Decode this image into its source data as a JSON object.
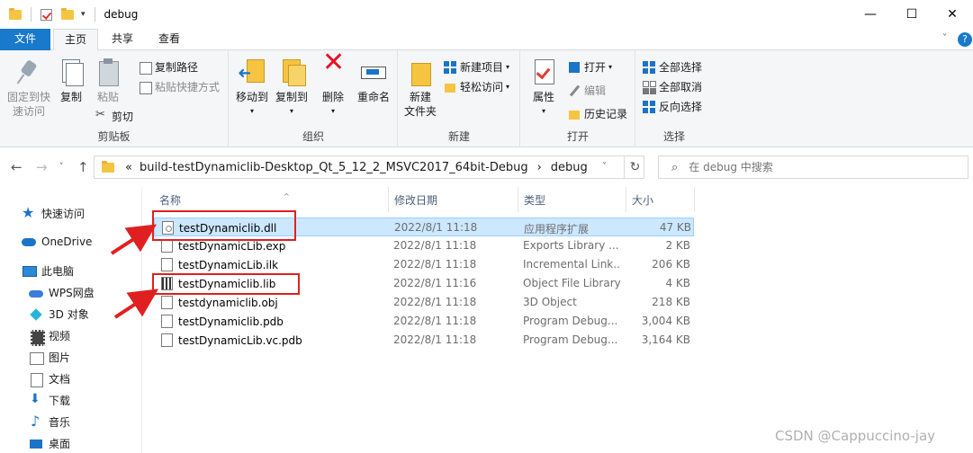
{
  "window": {
    "title": "debug",
    "minimize": "—",
    "maximize": "☐",
    "close": "✕"
  },
  "tabs": [
    {
      "label": "文件"
    },
    {
      "label": "主页"
    },
    {
      "label": "共享"
    },
    {
      "label": "查看"
    }
  ],
  "help": "?",
  "ribbon": {
    "clipboard": {
      "group_label": "剪贴板",
      "pin_quick_access_line1": "固定到快",
      "pin_quick_access_line2": "速访问",
      "copy": "复制",
      "paste": "粘贴",
      "copy_path": "复制路径",
      "paste_shortcut": "粘贴快捷方式",
      "cut": "剪切"
    },
    "organize": {
      "group_label": "组织",
      "move_to": "移动到",
      "copy_to": "复制到",
      "delete": "删除",
      "rename": "重命名"
    },
    "new": {
      "group_label": "新建",
      "new_folder_line1": "新建",
      "new_folder_line2": "文件夹",
      "new_item": "新建项目",
      "easy_access": "轻松访问"
    },
    "open": {
      "group_label": "打开",
      "properties": "属性",
      "open": "打开",
      "edit": "编辑",
      "history": "历史记录"
    },
    "select": {
      "group_label": "选择",
      "select_all": "全部选择",
      "select_none": "全部取消",
      "invert_selection": "反向选择"
    }
  },
  "address": {
    "path_prefix": "«",
    "segment1": "build-testDynamiclib-Desktop_Qt_5_12_2_MSVC2017_64bit-Debug",
    "separator": "›",
    "segment2": "debug"
  },
  "search": {
    "placeholder": "在 debug 中搜索"
  },
  "navpane": [
    {
      "label": "快速访问"
    },
    {
      "label": "OneDrive"
    },
    {
      "label": "此电脑"
    },
    {
      "label": "WPS网盘"
    },
    {
      "label": "3D 对象"
    },
    {
      "label": "视频"
    },
    {
      "label": "图片"
    },
    {
      "label": "文档"
    },
    {
      "label": "下载"
    },
    {
      "label": "音乐"
    },
    {
      "label": "桌面"
    }
  ],
  "columns": {
    "name": "名称",
    "date": "修改日期",
    "type": "类型",
    "size": "大小"
  },
  "files": [
    {
      "name": "testDynamiclib.dll",
      "date": "2022/8/1 11:18",
      "type": "应用程序扩展",
      "size": "47 KB"
    },
    {
      "name": "testDynamicLib.exp",
      "date": "2022/8/1 11:18",
      "type": "Exports Library ...",
      "size": "2 KB"
    },
    {
      "name": "testDynamicLib.ilk",
      "date": "2022/8/1 11:18",
      "type": "Incremental Link...",
      "size": "206 KB"
    },
    {
      "name": "testDynamiclib.lib",
      "date": "2022/8/1 11:16",
      "type": "Object File Library",
      "size": "4 KB"
    },
    {
      "name": "testdynamiclib.obj",
      "date": "2022/8/1 11:18",
      "type": "3D Object",
      "size": "218 KB"
    },
    {
      "name": "testDynamiclib.pdb",
      "date": "2022/8/1 11:18",
      "type": "Program Debug...",
      "size": "3,004 KB"
    },
    {
      "name": "testDynamicLib.vc.pdb",
      "date": "2022/8/1 11:18",
      "type": "Program Debug...",
      "size": "3,164 KB"
    }
  ],
  "watermark": "CSDN @Cappuccino-jay",
  "colors": {
    "accent": "#1979ca",
    "selection": "#cce8ff",
    "annotation_red": "#e02020"
  }
}
